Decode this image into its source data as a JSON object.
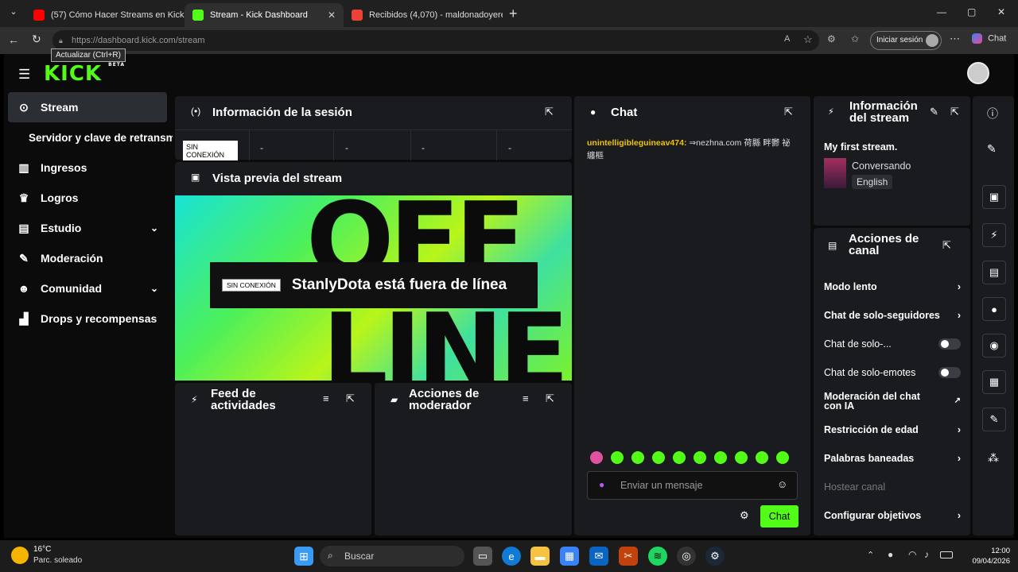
{
  "browser": {
    "tabs": [
      {
        "label": "(57) Cómo Hacer Streams en Kick",
        "icon": "youtube-icon",
        "color": "#ff0000"
      },
      {
        "label": "Stream - Kick Dashboard",
        "icon": "kick-icon",
        "color": "#53fc18"
      },
      {
        "label": "Recibidos (4,070) - maldonadoyere",
        "icon": "gmail-icon",
        "color": "#ea4335"
      }
    ],
    "url": "https://dashboard.kick.com/stream",
    "tooltip": "Actualizar (Ctrl+R)",
    "signin_label": "Iniciar sesión",
    "copilot_label": "Chat"
  },
  "app": {
    "logo": "KICK",
    "logo_badge": "BETA",
    "accent": "#53fc18"
  },
  "sidebar": {
    "items": [
      {
        "label": "Stream",
        "icon": "stream-icon"
      },
      {
        "label": "Servidor y clave de retransmisión"
      },
      {
        "label": "Ingresos",
        "icon": "chart-icon"
      },
      {
        "label": "Logros",
        "icon": "trophy-icon"
      },
      {
        "label": "Estudio",
        "icon": "studio-icon"
      },
      {
        "label": "Moderación",
        "icon": "wrench-icon"
      },
      {
        "label": "Comunidad",
        "icon": "community-icon"
      },
      {
        "label": "Drops y recompensas",
        "icon": "drops-icon"
      }
    ]
  },
  "session": {
    "title": "Información de la sesión",
    "status_badge": "SIN CONEXIÓN",
    "stats": [
      "-",
      "-",
      "-",
      "-"
    ]
  },
  "preview": {
    "title": "Vista previa del stream",
    "badge": "SIN CONEXIÓN",
    "message": "StanlyDota está fuera de línea",
    "bg_text_top": "OFF",
    "bg_text_bottom": "LINE"
  },
  "activity": {
    "title": "Feed de actividades"
  },
  "modactions": {
    "title": "Acciones de moderador"
  },
  "chat": {
    "title": "Chat",
    "messages": [
      {
        "user": "unintelligibleguineav474:",
        "text": "⇒nezhna.com 荷縣 畔鬱 祕 纏樞"
      }
    ],
    "input_placeholder": "Enviar un mensaje",
    "send_label": "Chat"
  },
  "streaminfo": {
    "title_line1": "Información",
    "title_line2": "del stream",
    "stream_title": "My first stream.",
    "category": "Conversando",
    "language": "English"
  },
  "channel": {
    "title_line1": "Acciones de",
    "title_line2": "canal",
    "actions": [
      {
        "label": "Modo lento",
        "kind": "chevron"
      },
      {
        "label": "Chat de solo-seguidores",
        "kind": "chevron"
      },
      {
        "label": "Chat de solo-...",
        "kind": "toggle"
      },
      {
        "label": "Chat de solo-emotes",
        "kind": "toggle"
      },
      {
        "label": "Moderación del chat con IA",
        "kind": "external"
      },
      {
        "label": "Restricción de edad",
        "kind": "chevron"
      },
      {
        "label": "Palabras baneadas",
        "kind": "chevron"
      },
      {
        "label": "Hostear canal",
        "kind": "disabled"
      },
      {
        "label": "Configurar objetivos",
        "kind": "chevron"
      }
    ]
  },
  "taskbar": {
    "weather_temp": "16°C",
    "weather_desc": "Parc. soleado",
    "search_label": "Buscar",
    "time": "12:00",
    "date": "09/04/2026"
  }
}
